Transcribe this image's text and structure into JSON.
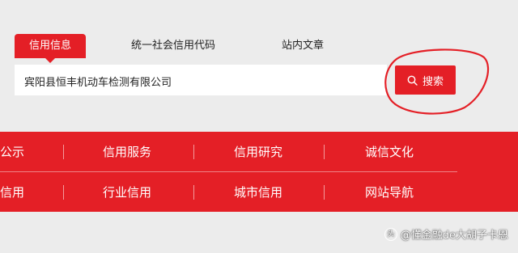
{
  "tabs": {
    "active": "信用信息",
    "items": [
      "统一社会信用代码",
      "站内文章"
    ]
  },
  "search": {
    "value": "宾阳县恒丰机动车检测有限公司",
    "button_label": "搜索",
    "button_icon": "search-icon"
  },
  "nav": {
    "row1": [
      "公示",
      "信用服务",
      "信用研究",
      "诚信文化"
    ],
    "row2": [
      "信用",
      "行业信用",
      "城市信用",
      "网站导航"
    ]
  },
  "watermark": {
    "text": "@懂金融de大胡子卡恩"
  },
  "colors": {
    "accent": "#e41f26",
    "annotation": "#e41f26",
    "background": "#ececec"
  }
}
